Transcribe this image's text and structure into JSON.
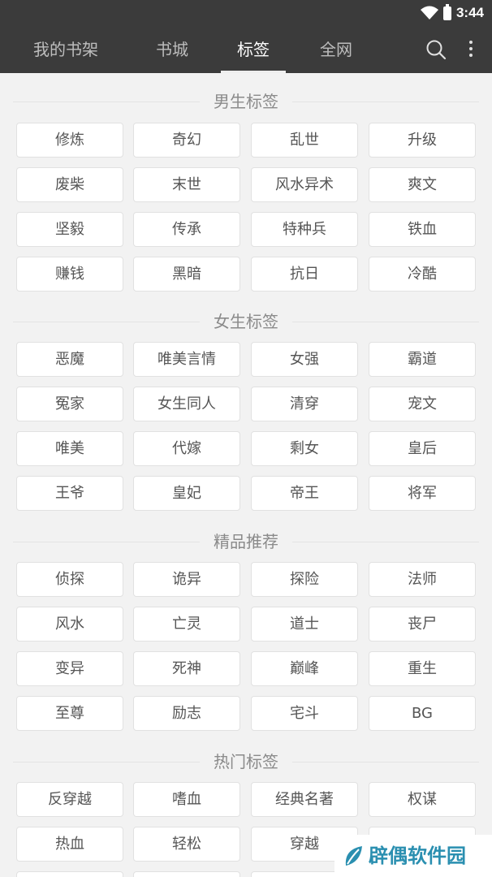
{
  "status_bar": {
    "time": "3:44"
  },
  "nav": {
    "tabs": [
      {
        "label": "我的书架",
        "active": false
      },
      {
        "label": "书城",
        "active": false
      },
      {
        "label": "标签",
        "active": true
      },
      {
        "label": "全网",
        "active": false
      }
    ],
    "icons": {
      "search": "search-icon",
      "more": "more-vert-icon"
    }
  },
  "sections": [
    {
      "title": "男生标签",
      "tags": [
        "修炼",
        "奇幻",
        "乱世",
        "升级",
        "废柴",
        "末世",
        "风水异术",
        "爽文",
        "坚毅",
        "传承",
        "特种兵",
        "铁血",
        "赚钱",
        "黑暗",
        "抗日",
        "冷酷"
      ]
    },
    {
      "title": "女生标签",
      "tags": [
        "恶魔",
        "唯美言情",
        "女强",
        "霸道",
        "冤家",
        "女生同人",
        "清穿",
        "宠文",
        "唯美",
        "代嫁",
        "剩女",
        "皇后",
        "王爷",
        "皇妃",
        "帝王",
        "将军"
      ]
    },
    {
      "title": "精品推荐",
      "tags": [
        "侦探",
        "诡异",
        "探险",
        "法师",
        "风水",
        "亡灵",
        "道士",
        "丧尸",
        "变异",
        "死神",
        "巅峰",
        "重生",
        "至尊",
        "励志",
        "宅斗",
        "BG"
      ]
    },
    {
      "title": "热门标签",
      "tags": [
        "反穿越",
        "嗜血",
        "经典名著",
        "权谋",
        "热血",
        "轻松",
        "穿越",
        ""
      ]
    }
  ],
  "watermark": {
    "text": "辟偶软件园"
  },
  "colors": {
    "header": "#3b3b3b",
    "background": "#f2f2f2",
    "tag_bg": "#ffffff",
    "watermark": "#2a8fb0"
  }
}
